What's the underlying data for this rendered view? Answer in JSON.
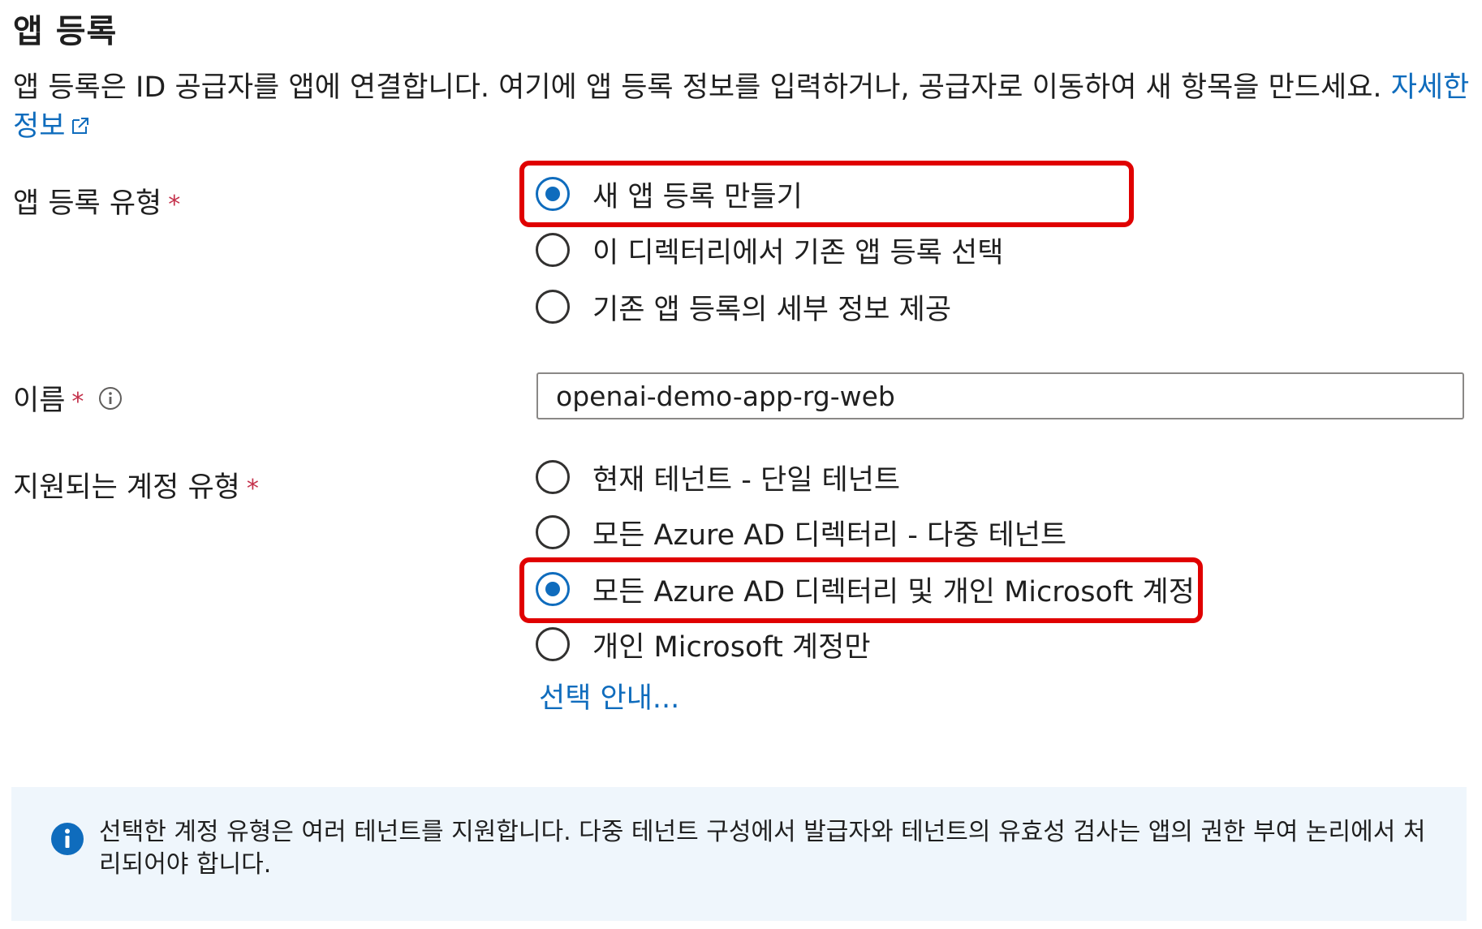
{
  "page": {
    "title": "앱 등록",
    "description": "앱 등록은 ID 공급자를 앱에 연결합니다. 여기에 앱 등록 정보를 입력하거나, 공급자로 이동하여 새 항목을 만드세요.",
    "learn_more_link": "자세한 정보"
  },
  "app_registration_type": {
    "label": "앱 등록 유형",
    "required_mark": "*",
    "options": [
      {
        "label": "새 앱 등록 만들기",
        "checked": true
      },
      {
        "label": "이 디렉터리에서 기존 앱 등록 선택",
        "checked": false
      },
      {
        "label": "기존 앱 등록의 세부 정보 제공",
        "checked": false
      }
    ]
  },
  "name_field": {
    "label": "이름",
    "required_mark": "*",
    "value": "openai-demo-app-rg-web",
    "info_icon": "info-icon"
  },
  "supported_account_types": {
    "label": "지원되는 계정 유형",
    "required_mark": "*",
    "options": [
      {
        "label": "현재 테넌트 - 단일 테넌트",
        "checked": false
      },
      {
        "label": "모든 Azure AD 디렉터리 - 다중 테넌트",
        "checked": false
      },
      {
        "label": "모든 Azure AD 디렉터리 및 개인 Microsoft 계정",
        "checked": true
      },
      {
        "label": "개인 Microsoft 계정만",
        "checked": false
      }
    ],
    "help_link": "선택 안내..."
  },
  "info_banner": {
    "icon": "info-circle-icon",
    "text": "선택한 계정 유형은 여러 테넌트를 지원합니다. 다중 테넌트 구성에서 발급자와 테넌트의 유효성 검사는 앱의 권한 부여 논리에서 처리되어야 합니다."
  },
  "colors": {
    "accent": "#0f6cbd",
    "highlight": "#e00000",
    "required": "#c4314b",
    "banner_bg": "#eff6fc"
  }
}
